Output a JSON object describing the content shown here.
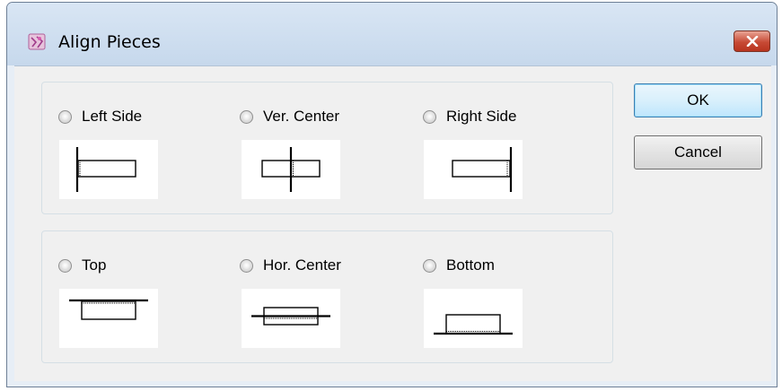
{
  "window": {
    "title": "Align Pieces",
    "icon": "app-icon",
    "close_icon": "close-icon"
  },
  "groups": [
    {
      "name": "horizontal-alignment",
      "options": [
        {
          "label": "Left Side",
          "icon": "align-left-icon"
        },
        {
          "label": "Ver. Center",
          "icon": "align-vertical-center-icon"
        },
        {
          "label": "Right Side",
          "icon": "align-right-icon"
        }
      ]
    },
    {
      "name": "vertical-alignment",
      "options": [
        {
          "label": "Top",
          "icon": "align-top-icon"
        },
        {
          "label": "Hor. Center",
          "icon": "align-horizontal-center-icon"
        },
        {
          "label": "Bottom",
          "icon": "align-bottom-icon"
        }
      ]
    }
  ],
  "buttons": {
    "ok_label": "OK",
    "cancel_label": "Cancel"
  },
  "colors": {
    "close_button": "#c74a35",
    "default_button_border": "#3c7fb1",
    "dialog_background": "#f0f0f0"
  }
}
